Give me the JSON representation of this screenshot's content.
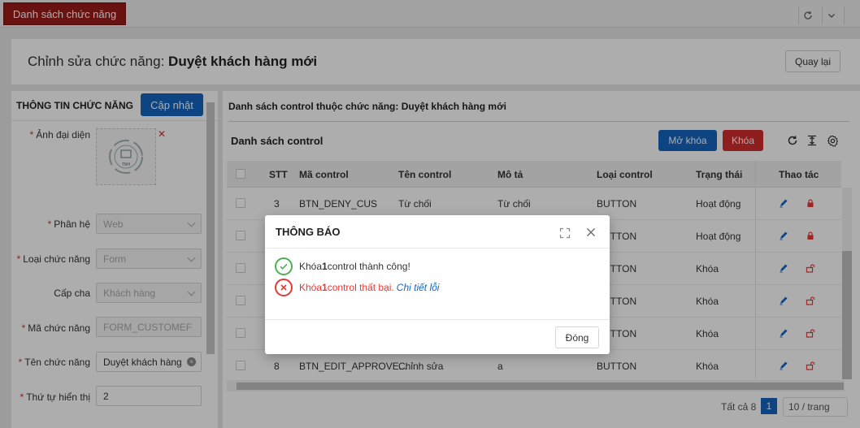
{
  "tabbar": {
    "active_tab": "Danh sách chức năng"
  },
  "header": {
    "title_prefix": "Chỉnh sửa chức năng:",
    "title_name": "Duyệt khách hàng mới",
    "back_label": "Quay lại"
  },
  "left": {
    "title": "THÔNG TIN CHỨC NĂNG",
    "update_label": "Cập nhật",
    "avatar_text": "TNH",
    "fields": {
      "avatar": "Ảnh đại diện",
      "subsystem_label": "Phân hệ",
      "subsystem_value": "Web",
      "type_label": "Loại chức năng",
      "type_value": "Form",
      "parent_label": "Cấp cha",
      "parent_value": "Khách hàng",
      "code_label": "Mã chức năng",
      "code_value": "FORM_CUSTOMEF",
      "name_label": "Tên chức năng",
      "name_value": "Duyệt khách hàng",
      "order_label": "Thứ tự hiển thị",
      "order_value": "2"
    }
  },
  "right": {
    "subtitle_prefix": "Danh sách control thuộc chức năng:",
    "subtitle_name": "Duyệt khách hàng mới",
    "list_title": "Danh sách control",
    "unlock_label": "Mở khóa",
    "lock_label": "Khóa",
    "columns": {
      "stt": "STT",
      "code": "Mã control",
      "name": "Tên control",
      "desc": "Mô tả",
      "type": "Loại control",
      "status": "Trạng thái",
      "actions": "Thao tác"
    },
    "rows": [
      {
        "stt": "3",
        "code": "BTN_DENY_CUS",
        "name": "Từ chối",
        "desc": "Từ chối",
        "type": "BUTTON",
        "status": "Hoạt động",
        "locked": true
      },
      {
        "stt": "",
        "code": "",
        "name": "",
        "desc": "",
        "type": "BUTTON",
        "status": "Hoạt động",
        "locked": true
      },
      {
        "stt": "",
        "code": "",
        "name": "",
        "desc": "",
        "type": "BUTTON",
        "status": "Khóa",
        "locked": false
      },
      {
        "stt": "",
        "code": "",
        "name": "",
        "desc": "",
        "type": "BUTTON",
        "status": "Khóa",
        "locked": false
      },
      {
        "stt": "",
        "code": "",
        "name": "",
        "desc": "",
        "type": "BUTTON",
        "status": "Khóa",
        "locked": false
      },
      {
        "stt": "8",
        "code": "BTN_EDIT_APPROVE...",
        "name": "Chỉnh sửa",
        "desc": "a",
        "type": "BUTTON",
        "status": "Khóa",
        "locked": false
      }
    ],
    "total_label": "Tất cả 8",
    "current_page": "1",
    "page_size": "10 / trang"
  },
  "modal": {
    "title": "THÔNG BÁO",
    "success_pre": "Khóa ",
    "success_num": "1",
    "success_post": " control thành công!",
    "error_pre": "Khóa ",
    "error_num": "1",
    "error_post": " control thất bại.",
    "error_link": "Chi tiết lỗi",
    "close_label": "Đóng"
  },
  "colors": {
    "tab_active": "#9b1b1b",
    "primary": "#1565c0",
    "danger": "#d32f2f",
    "success": "#4caf50"
  }
}
